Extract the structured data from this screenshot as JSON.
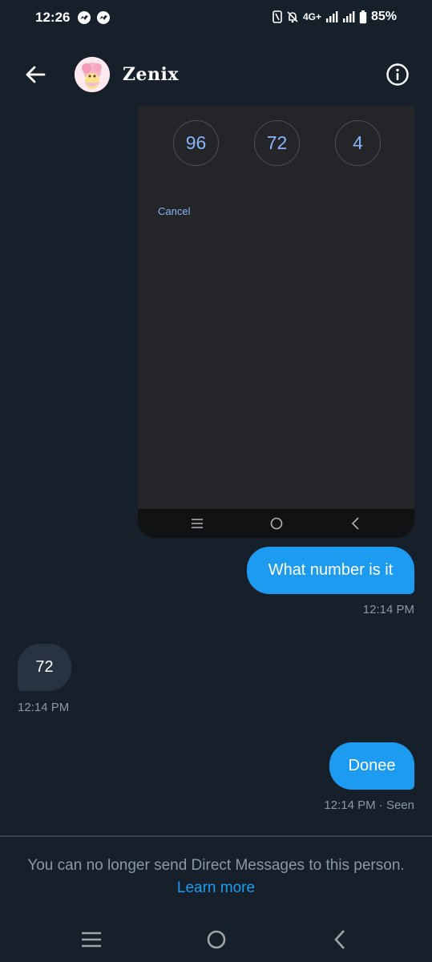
{
  "status_bar": {
    "time": "12:26",
    "network": "4G+",
    "battery": "85%",
    "icons": [
      "messenger-icon",
      "messenger-icon",
      "nfc-icon",
      "mute-bell-icon",
      "signal-icon",
      "signal-icon",
      "battery-icon"
    ]
  },
  "header": {
    "display_name": "Zenix",
    "icons": [
      "back-arrow-icon",
      "info-icon"
    ]
  },
  "media": {
    "numbers": [
      "96",
      "72",
      "4"
    ],
    "cancel_label": "Cancel",
    "nav_icons": [
      "recents-icon",
      "home-icon",
      "back-icon"
    ]
  },
  "messages": [
    {
      "direction": "out",
      "text": "What number is it",
      "time": "12:14 PM"
    },
    {
      "direction": "in",
      "text": "72",
      "time": "12:14 PM"
    },
    {
      "direction": "out",
      "text": "Donee",
      "time": "12:14 PM · Seen"
    }
  ],
  "footer": {
    "notice": "You can no longer send Direct Messages to this person.",
    "learn_more": "Learn more"
  },
  "system_nav": {
    "icons": [
      "recents-icon",
      "home-icon",
      "back-icon"
    ]
  },
  "colors": {
    "background": "#15202b",
    "accent": "#1d9bf0",
    "incoming_bubble": "#273340",
    "muted_text": "#8b98a5"
  }
}
